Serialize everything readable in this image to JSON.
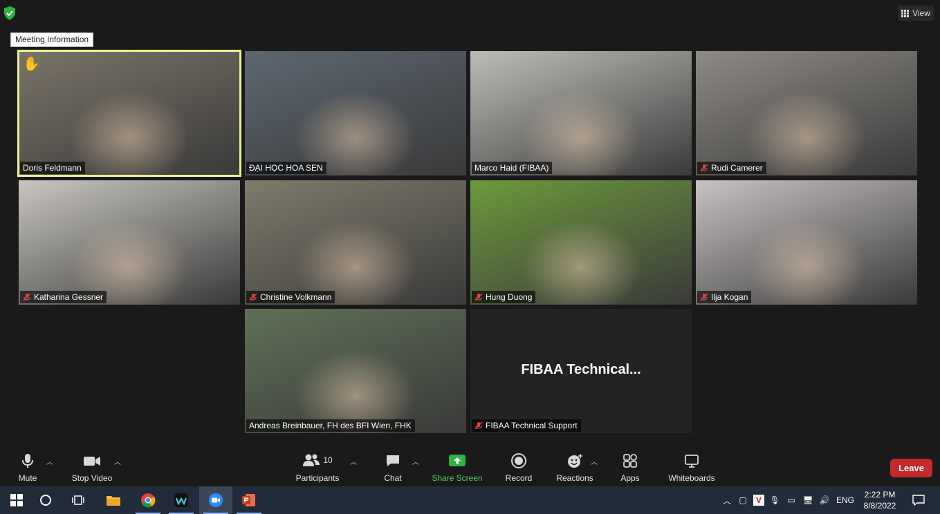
{
  "window": {
    "view_label": "View",
    "tooltip": "Meeting Information"
  },
  "participants": [
    {
      "name": "Doris Feldmann",
      "muted": false,
      "hand_raised": true,
      "active": true,
      "bg": "#7b7468"
    },
    {
      "name": "ĐẠI HỌC HOA SEN",
      "muted": false,
      "hand_raised": false,
      "active": false,
      "bg": "#5d6772"
    },
    {
      "name": "Marco Haid (FIBAA)",
      "muted": false,
      "hand_raised": false,
      "active": false,
      "bg": "#bdbdb8"
    },
    {
      "name": "Rudi Camerer",
      "muted": true,
      "hand_raised": false,
      "active": false,
      "bg": "#8e8a84"
    },
    {
      "name": "Katharina Gessner",
      "muted": true,
      "hand_raised": false,
      "active": false,
      "bg": "#c9c6c0"
    },
    {
      "name": "Christine Volkmann",
      "muted": true,
      "hand_raised": false,
      "active": false,
      "bg": "#7f7c6c"
    },
    {
      "name": "Hung Duong",
      "muted": true,
      "hand_raised": false,
      "active": false,
      "bg": "#6c9a3c"
    },
    {
      "name": "Ilja Kogan",
      "muted": true,
      "hand_raised": false,
      "active": false,
      "bg": "#c8c2c2"
    },
    {
      "name": "Andreas Breinbauer, FH des BFI Wien, FHK",
      "muted": false,
      "hand_raised": false,
      "active": false,
      "bg": "#5f7056"
    },
    {
      "name": "FIBAA Technical Support",
      "muted": true,
      "hand_raised": false,
      "active": false,
      "bg": "#232323",
      "display_text": "FIBAA  Technical..."
    }
  ],
  "toolbar": {
    "mute": "Mute",
    "stop_video": "Stop Video",
    "participants": "Participants",
    "participants_count": "10",
    "chat": "Chat",
    "share_screen": "Share Screen",
    "record": "Record",
    "reactions": "Reactions",
    "apps": "Apps",
    "whiteboards": "Whiteboards",
    "leave": "Leave"
  },
  "taskbar": {
    "language": "ENG",
    "time": "2:22 PM",
    "date": "8/8/2022"
  },
  "colors": {
    "active_border": "#e9f58e",
    "share_green": "#4ed05f",
    "leave_red": "#c52a2a",
    "mute_red": "#e04545"
  }
}
